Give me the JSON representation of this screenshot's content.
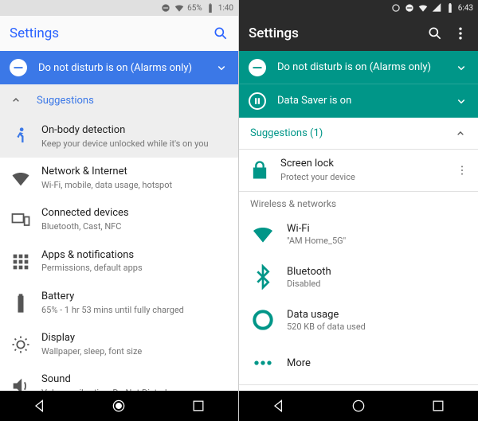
{
  "left": {
    "status": {
      "battery": "65%",
      "time": "1:40"
    },
    "title": "Settings",
    "banner": {
      "text": "Do not disturb is on (Alarms only)"
    },
    "suggestions_label": "Suggestions",
    "suggestion_row": {
      "title": "On-body detection",
      "sub": "Keep your device unlocked while it's on you"
    },
    "items": [
      {
        "title": "Network & Internet",
        "sub": "Wi-Fi, mobile, data usage, hotspot"
      },
      {
        "title": "Connected devices",
        "sub": "Bluetooth, Cast, NFC"
      },
      {
        "title": "Apps & notifications",
        "sub": "Permissions, default apps"
      },
      {
        "title": "Battery",
        "sub": "65% - 1 hr 53 mins until fully charged"
      },
      {
        "title": "Display",
        "sub": "Wallpaper, sleep, font size"
      },
      {
        "title": "Sound",
        "sub": "Volume, vibration, Do Not Disturb"
      }
    ]
  },
  "right": {
    "status": {
      "time": "6:43"
    },
    "title": "Settings",
    "banners": [
      {
        "text": "Do not disturb is on (Alarms only)"
      },
      {
        "text": "Data Saver is on"
      }
    ],
    "suggestions_label": "Suggestions (1)",
    "suggestion_row": {
      "title": "Screen lock",
      "sub": "Protect your device"
    },
    "category": "Wireless & networks",
    "items": [
      {
        "title": "Wi-Fi",
        "sub": "\"AM Home_5G\""
      },
      {
        "title": "Bluetooth",
        "sub": "Disabled"
      },
      {
        "title": "Data usage",
        "sub": "520 KB of data used"
      },
      {
        "title": "More",
        "sub": ""
      }
    ]
  }
}
